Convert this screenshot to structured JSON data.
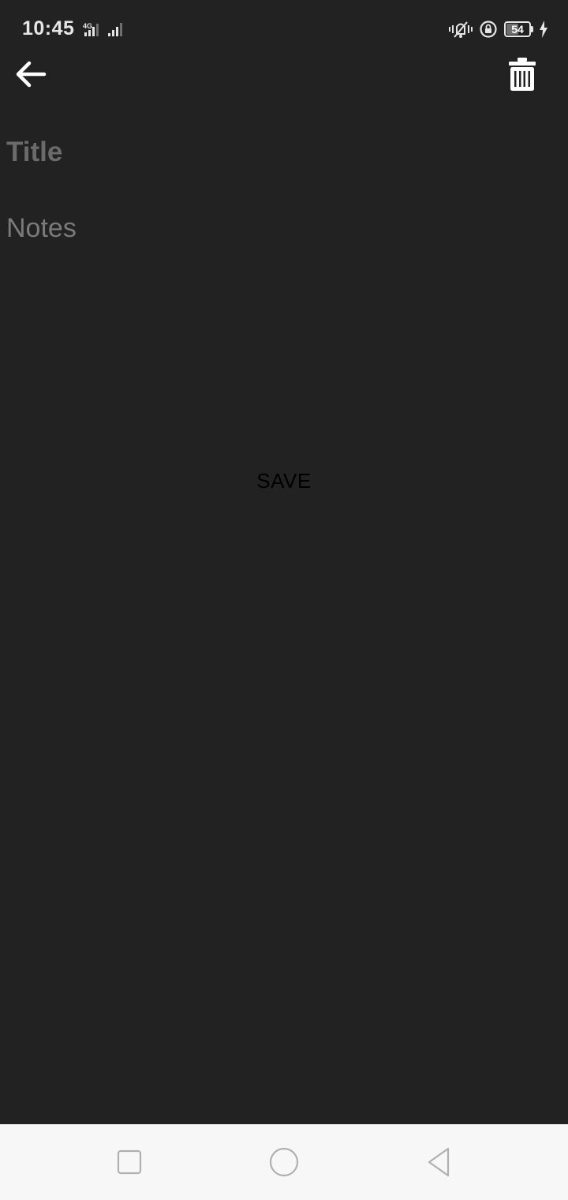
{
  "status_bar": {
    "time": "10:45",
    "network_type": "4G",
    "battery_level": "54",
    "battery_fraction": 0.54,
    "icons": [
      "signal-icon",
      "vibrate-icon",
      "rotation-lock-icon",
      "battery-icon",
      "charging-icon"
    ]
  },
  "toolbar": {
    "back_icon": "arrow-left-icon",
    "delete_icon": "trash-icon"
  },
  "editor": {
    "title_placeholder": "Title",
    "title_value": "",
    "notes_placeholder": "Notes",
    "notes_value": "",
    "save_label": "SAVE"
  },
  "nav_bar": {
    "icons": [
      "recents-square-icon",
      "home-circle-icon",
      "back-triangle-icon"
    ]
  },
  "colors": {
    "background": "#222222",
    "placeholder": "#6b6b6b",
    "nav_bar": "#f7f7f7",
    "save_text": "#000000"
  }
}
